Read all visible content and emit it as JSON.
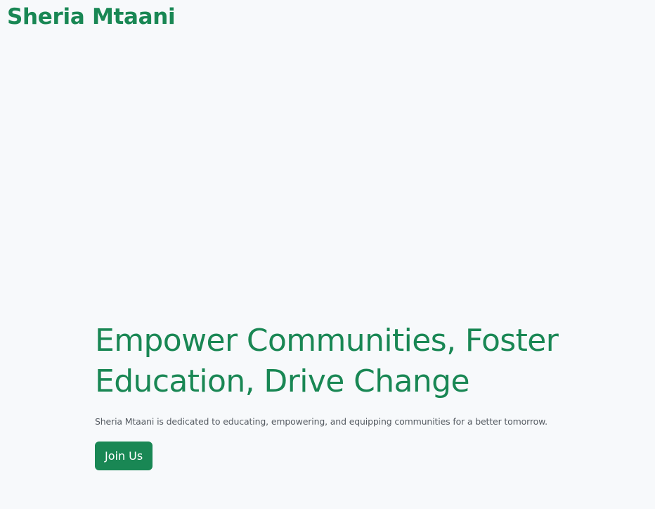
{
  "header": {
    "brand": "Sheria Mtaani"
  },
  "hero": {
    "title_line1": "Empower Communities, Foster",
    "title_line2": "Education, Drive Change",
    "description": "Sheria Mtaani is dedicated to educating, empowering, and equipping communities for a better tomorrow.",
    "cta_label": "Join Us"
  },
  "colors": {
    "brand_green": "#198754",
    "background": "#f7f9fb",
    "body_text": "#555b62"
  }
}
